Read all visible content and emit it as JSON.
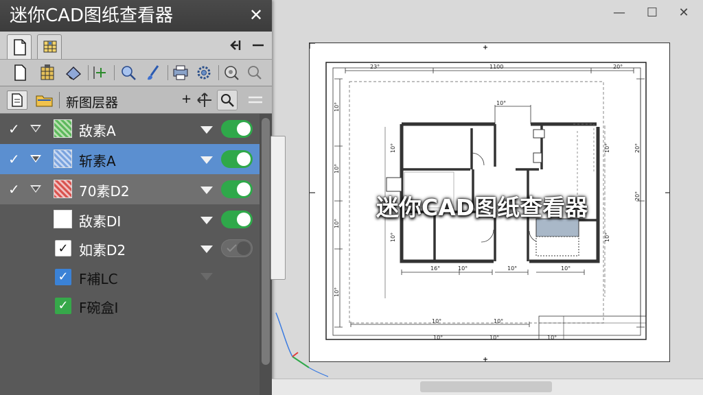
{
  "panel": {
    "title": "迷你CAD图纸查看器",
    "close_glyph": "✕",
    "header_label": "新图层器",
    "header_plus": "+"
  },
  "layers": [
    {
      "label": "敌素A",
      "check": "✓",
      "swatch": "green-hatch",
      "visible": true,
      "selected": false
    },
    {
      "label": "斩素A",
      "check": "✓",
      "swatch": "blue-hatch",
      "visible": true,
      "selected": true
    },
    {
      "label": "70素D2",
      "check": "✓",
      "swatch": "red-hatch",
      "visible": true,
      "selected": false
    },
    {
      "label": "敌素DI",
      "swatch": "white",
      "visible": true,
      "selected": false
    },
    {
      "label": "如素D2",
      "checkbox": "✓",
      "checkbox_style": "white",
      "visible": false,
      "selected": false
    },
    {
      "label": "F補LC",
      "checkbox": "✓",
      "checkbox_style": "blue",
      "selected": false
    },
    {
      "label": "F碗盒I",
      "checkbox": "✓",
      "checkbox_style": "green",
      "selected": false
    }
  ],
  "window": {
    "minimize": "—",
    "maximize": "☐",
    "close": "✕"
  },
  "drawing": {
    "dims": {
      "top_left": "23°",
      "top_mid": "1100",
      "top_right": "20°",
      "bay": "10°",
      "left_a": "10°",
      "left_b": "10°",
      "left_c": "10°",
      "left_d": "10°",
      "right_a": "10°",
      "right_b": "10°",
      "right_c": "20°",
      "right_d": "20°",
      "bottom_a": "16°",
      "bottom_b": "10°",
      "bottom_c": "10°",
      "base_a": "10°",
      "base_b": "10°",
      "base_c": "10°",
      "foot_a": "10°",
      "foot_b": "10°"
    },
    "overlay_title": "迷你CAD图纸查看器"
  },
  "colors": {
    "toggle_on": "#2fa84a",
    "selection": "#5b8fd0",
    "panel_bg": "#595959"
  }
}
